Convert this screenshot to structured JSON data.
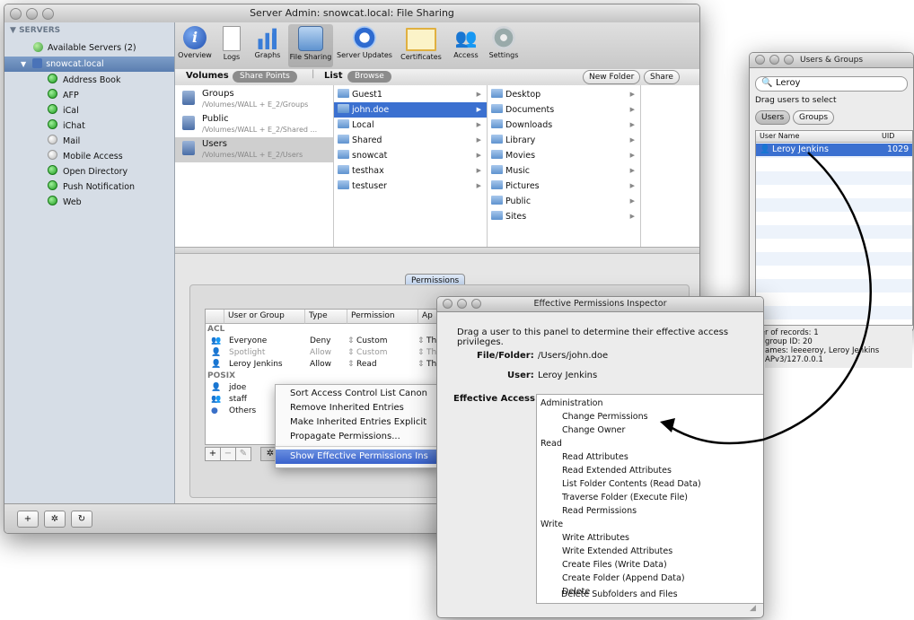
{
  "main_window": {
    "title": "Server Admin: snowcat.local: File Sharing",
    "sidebar": {
      "header": "SERVERS",
      "servers": [
        {
          "label": "Available Servers (2)"
        },
        {
          "label": "snowcat.local"
        }
      ],
      "services": [
        {
          "label": "Address Book",
          "status": "on"
        },
        {
          "label": "AFP",
          "status": "on"
        },
        {
          "label": "iCal",
          "status": "on"
        },
        {
          "label": "iChat",
          "status": "on"
        },
        {
          "label": "Mail",
          "status": "off"
        },
        {
          "label": "Mobile Access",
          "status": "off"
        },
        {
          "label": "Open Directory",
          "status": "on"
        },
        {
          "label": "Push Notification",
          "status": "on"
        },
        {
          "label": "Web",
          "status": "on"
        }
      ],
      "footer_buttons": [
        "+",
        "✲",
        "↻"
      ]
    },
    "toolbar": [
      {
        "label": "Overview",
        "icon": "info-icon"
      },
      {
        "label": "Logs",
        "icon": "logs-icon"
      },
      {
        "label": "Graphs",
        "icon": "graphs-icon"
      },
      {
        "label": "File Sharing",
        "icon": "file-sharing-icon",
        "selected": true
      },
      {
        "label": "Server Updates",
        "icon": "server-updates-icon"
      },
      {
        "label": "Certificates",
        "icon": "certificates-icon"
      },
      {
        "label": "Access",
        "icon": "access-icon"
      },
      {
        "label": "Settings",
        "icon": "settings-icon"
      }
    ],
    "subbar": {
      "volumes_label": "Volumes",
      "share_points_label": "Share Points",
      "list_label": "List",
      "browse_label": "Browse",
      "new_folder_label": "New Folder",
      "share_label": "Share"
    },
    "share_points": [
      {
        "name": "Groups",
        "path": "/Volumes/WALL + E_2/Groups"
      },
      {
        "name": "Public",
        "path": "/Volumes/WALL + E_2/Shared ..."
      },
      {
        "name": "Users",
        "path": "/Volumes/WALL + E_2/Users"
      }
    ],
    "column1": [
      "Guest1",
      "john.doe",
      "Local",
      "Shared",
      "snowcat",
      "testhax",
      "testuser"
    ],
    "column2": [
      "Desktop",
      "Documents",
      "Downloads",
      "Library",
      "Movies",
      "Music",
      "Pictures",
      "Public",
      "Sites"
    ],
    "permissions_tab": "Permissions",
    "perm_table": {
      "headers": [
        "User or Group",
        "Type",
        "Permission",
        "Ap"
      ],
      "acl_label": "ACL",
      "acl_rows": [
        {
          "name": "Everyone",
          "type": "Deny",
          "perm": "Custom",
          "applies": "Thi"
        },
        {
          "name": "Spotlight",
          "type": "Allow",
          "perm": "Custom",
          "applies": "Thi"
        },
        {
          "name": "Leroy Jenkins",
          "type": "Allow",
          "perm": "Read",
          "applies": "Thi"
        }
      ],
      "posix_label": "POSIX",
      "posix_rows": [
        {
          "name": "jdoe"
        },
        {
          "name": "staff"
        },
        {
          "name": "Others"
        }
      ]
    },
    "context_menu": [
      "Sort Access Control List Canon",
      "Remove Inherited Entries",
      "Make Inherited Entries Explicit",
      "Propagate Permissions...",
      "Show Effective Permissions Ins"
    ],
    "table_buttons": [
      "+",
      "−",
      "✎",
      "✲"
    ]
  },
  "users_groups": {
    "title": "Users & Groups",
    "search_value": "Leroy",
    "hint": "Drag users to select",
    "users_tab": "Users",
    "groups_tab": "Groups",
    "col_username": "User Name",
    "col_uid": "UID",
    "rows": [
      {
        "name": "Leroy Jenkins",
        "uid": "1029"
      }
    ],
    "info": [
      "r of records: 1",
      "group ID: 20",
      "ames: leeeeroy, Leroy Jenkins",
      "APv3/127.0.0.1"
    ]
  },
  "inspector": {
    "title": "Effective Permissions Inspector",
    "instructions": "Drag a user to this panel to determine their effective access privileges.",
    "file_label": "File/Folder:",
    "file_value": "/Users/john.doe",
    "user_label": "User:",
    "user_value": "Leroy Jenkins",
    "access_label": "Effective Access:",
    "groups": [
      {
        "title": "Administration",
        "items": [
          {
            "label": "Change Permissions",
            "checked": false
          },
          {
            "label": "Change Owner",
            "checked": false
          }
        ]
      },
      {
        "title": "Read",
        "items": [
          {
            "label": "Read Attributes",
            "checked": true
          },
          {
            "label": "Read Extended Attributes",
            "checked": true
          },
          {
            "label": "List Folder Contents (Read Data)",
            "checked": true
          },
          {
            "label": "Traverse Folder (Execute File)",
            "checked": true
          },
          {
            "label": "Read Permissions",
            "checked": true
          }
        ]
      },
      {
        "title": "Write",
        "items": [
          {
            "label": "Write Attributes",
            "checked": false
          },
          {
            "label": "Write Extended Attributes",
            "checked": false
          },
          {
            "label": "Create Files (Write Data)",
            "checked": false
          },
          {
            "label": "Create Folder (Append Data)",
            "checked": false
          },
          {
            "label": "Delete",
            "checked": false
          },
          {
            "label": "Delete Subfolders and Files",
            "checked": false
          }
        ]
      }
    ],
    "check_glyph": "√"
  }
}
